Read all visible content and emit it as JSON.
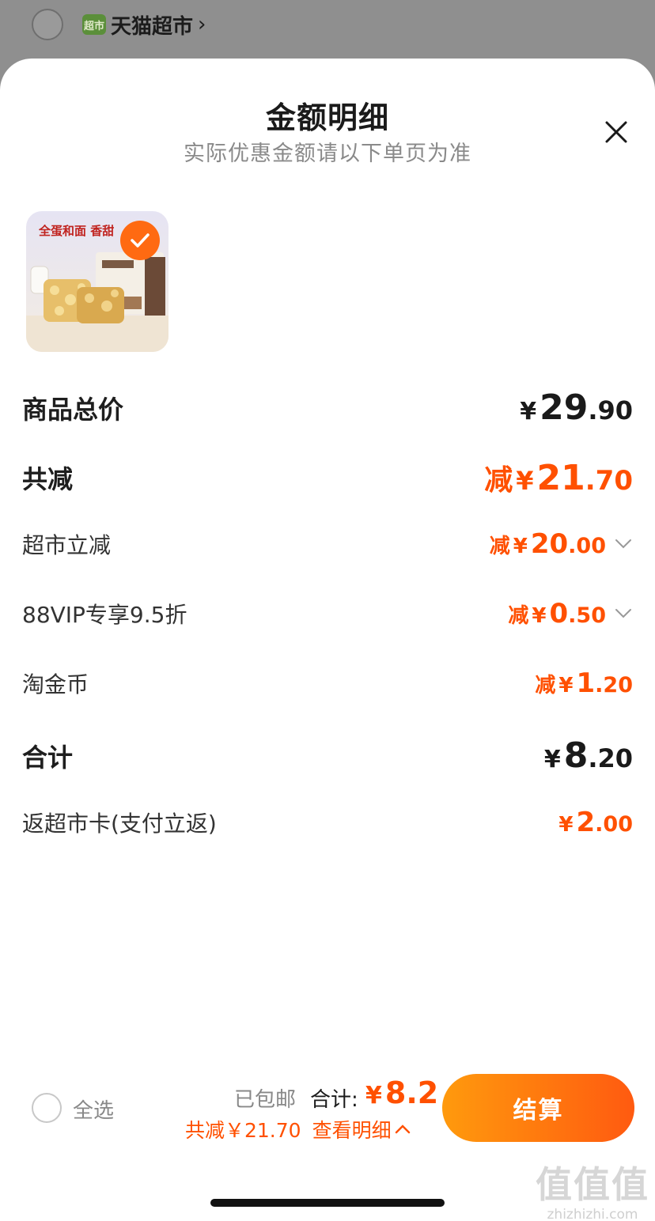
{
  "background": {
    "store_name": "天猫超市",
    "store_logo_text": "超市",
    "chevron": "›"
  },
  "sheet": {
    "title": "金额明细",
    "subtitle": "实际优惠金额请以下单页为准",
    "close_icon": "close-icon"
  },
  "product": {
    "image_text_top": "全蛋和面 香甜",
    "selected": true
  },
  "rows": {
    "subtotal": {
      "label": "商品总价",
      "yen": "¥",
      "int": "29",
      "dec": ".90"
    },
    "total_discount": {
      "label": "共减",
      "prefix": "减",
      "yen": "¥",
      "int": "21",
      "dec": ".70"
    },
    "supermarket_discount": {
      "label": "超市立减",
      "prefix": "减",
      "yen": "¥",
      "int": "20",
      "dec": ".00"
    },
    "vip_discount": {
      "label": "88VIP专享9.5折",
      "prefix": "减",
      "yen": "¥",
      "int": "0",
      "dec": ".50"
    },
    "coins": {
      "label": "淘金币",
      "prefix": "减",
      "yen": "¥",
      "int": "1",
      "dec": ".20"
    },
    "total": {
      "label": "合计",
      "yen": "¥",
      "int": "8",
      "dec": ".20"
    },
    "cashback": {
      "label": "返超市卡(支付立返)",
      "yen": "¥",
      "int": "2",
      "dec": ".00"
    }
  },
  "bottom_bar": {
    "select_all": "全选",
    "shipping": "已包邮",
    "total_label": "合计:",
    "total_yen": "¥",
    "total_value": "8.2",
    "savings_text": "共减￥21.70",
    "view_detail": "查看明细",
    "checkout": "结算"
  },
  "watermark": {
    "big": "值值值",
    "small": "zhizhizhi.com"
  },
  "colors": {
    "accent": "#ff5000",
    "checkout_gradient_start": "#ff9a0d",
    "checkout_gradient_end": "#ff5a10"
  }
}
